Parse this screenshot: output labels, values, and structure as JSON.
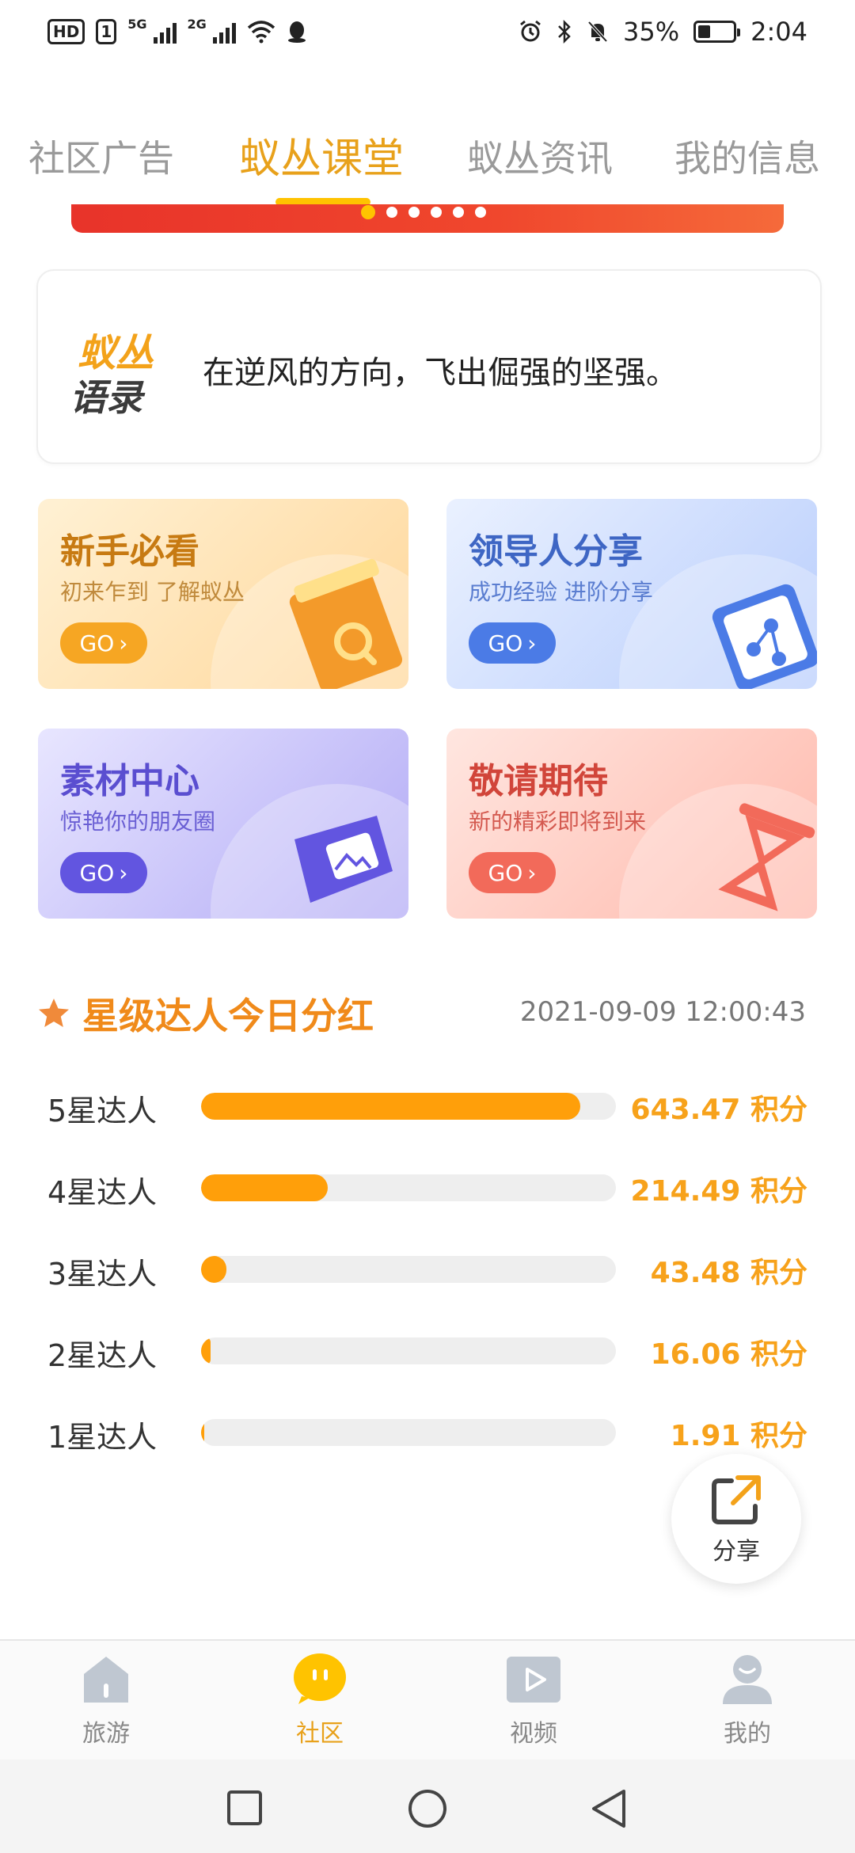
{
  "status_bar": {
    "hd": "HD",
    "sim1": "1",
    "net1": "5G",
    "net2": "2G",
    "battery": "35%",
    "battery_level": 0.35,
    "time": "2:04"
  },
  "tabs": [
    {
      "label": "社区广告",
      "active": false
    },
    {
      "label": "蚁丛课堂",
      "active": true
    },
    {
      "label": "蚁丛资讯",
      "active": false
    },
    {
      "label": "我的信息",
      "active": false
    }
  ],
  "banner": {
    "dot_count": 6,
    "active_index": 0
  },
  "quote": {
    "logo_line1": "蚁丛",
    "logo_line2": "语录",
    "text": "在逆风的方向，飞出倔强的坚强。"
  },
  "cards": [
    {
      "title": "新手必看",
      "subtitle": "初来乍到 了解蚁丛",
      "go": "GO"
    },
    {
      "title": "领导人分享",
      "subtitle": "成功经验 进阶分享",
      "go": "GO"
    },
    {
      "title": "素材中心",
      "subtitle": "惊艳你的朋友圈",
      "go": "GO"
    },
    {
      "title": "敬请期待",
      "subtitle": "新的精彩即将到来",
      "go": "GO"
    }
  ],
  "dividend": {
    "title": "星级达人今日分红",
    "timestamp": "2021-09-09 12:00:43",
    "rows": [
      {
        "label": "5星达人",
        "value": "643.47 积分",
        "ratio": 0.915
      },
      {
        "label": "4星达人",
        "value": "214.49 积分",
        "ratio": 0.305
      },
      {
        "label": "3星达人",
        "value": "43.48 积分",
        "ratio": 0.062
      },
      {
        "label": "2星达人",
        "value": "16.06 积分",
        "ratio": 0.022
      },
      {
        "label": "1星达人",
        "value": "1.91 积分",
        "ratio": 0.004
      }
    ]
  },
  "share": {
    "label": "分享"
  },
  "bottom_nav": [
    {
      "label": "旅游",
      "icon": "home-icon",
      "active": false
    },
    {
      "label": "社区",
      "icon": "community-icon",
      "active": true
    },
    {
      "label": "视频",
      "icon": "video-icon",
      "active": false
    },
    {
      "label": "我的",
      "icon": "profile-icon",
      "active": false
    }
  ],
  "colors": {
    "accent": "#e8a11b",
    "bar": "#ff9f0a",
    "value": "#f7a21b",
    "inactive_tab": "#9a9a9a"
  }
}
